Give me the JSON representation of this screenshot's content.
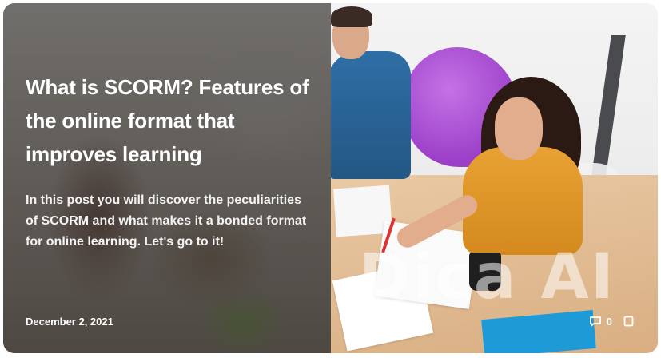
{
  "card": {
    "title": "What is SCORM? Features of the online format that improves learning",
    "excerpt": "In this post you will discover the peculiarities of SCORM and what makes it a bonded format for online learning. Let's go to it!",
    "date": "December 2, 2021",
    "comments_count": "0",
    "comment_icon": "comment-icon",
    "bookmark_icon": "bookmark-icon"
  },
  "watermark": {
    "text": "Dica AI"
  },
  "colors": {
    "overlay": "#282624",
    "text": "#ffffff",
    "folder_blue": "#1e9ad6",
    "beanbag_purple": "#9b3fc8",
    "shirt_orange": "#e8a133"
  }
}
